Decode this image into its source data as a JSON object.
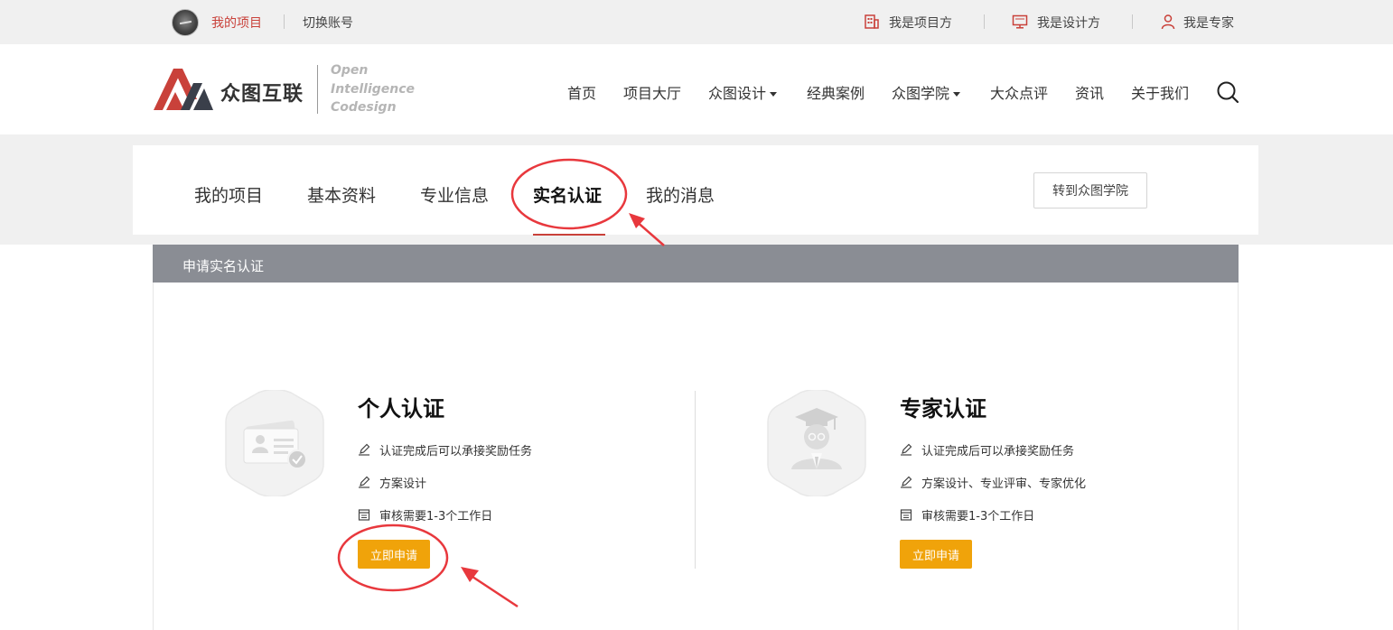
{
  "topbar": {
    "my_projects": "我的项目",
    "switch_account": "切换账号",
    "roles": [
      "我是项目方",
      "我是设计方",
      "我是专家"
    ]
  },
  "header": {
    "logo_cn": "众图互联",
    "logo_en": [
      "Open",
      "Intelligence",
      "Codesign"
    ],
    "nav": [
      {
        "label": "首页",
        "dropdown": false
      },
      {
        "label": "项目大厅",
        "dropdown": false
      },
      {
        "label": "众图设计",
        "dropdown": true
      },
      {
        "label": "经典案例",
        "dropdown": false
      },
      {
        "label": "众图学院",
        "dropdown": true
      },
      {
        "label": "大众点评",
        "dropdown": false
      },
      {
        "label": "资讯",
        "dropdown": false
      },
      {
        "label": "关于我们",
        "dropdown": false
      }
    ]
  },
  "tabs": {
    "items": [
      "我的项目",
      "基本资料",
      "专业信息",
      "实名认证",
      "我的消息"
    ],
    "active": "实名认证",
    "goto_label": "转到众图学院"
  },
  "card": {
    "title": "申请实名认证",
    "personal": {
      "title": "个人认证",
      "features": [
        "认证完成后可以承接奖励任务",
        "方案设计",
        "审核需要1-3个工作日"
      ],
      "button": "立即申请"
    },
    "expert": {
      "title": "专家认证",
      "features": [
        "认证完成后可以承接奖励任务",
        "方案设计、专业评审、专家优化",
        "审核需要1-3个工作日"
      ],
      "button": "立即申请"
    }
  },
  "colors": {
    "brand_red": "#c9413a",
    "button_orange": "#f0a30a",
    "card_header_gray": "#8a8d94",
    "annotation_red": "#e8383d"
  },
  "icons": [
    "avatar",
    "building-icon",
    "monitor-icon",
    "person-icon",
    "logo-mark",
    "search-icon",
    "id-card-icon",
    "expert-avatar-icon",
    "pencil-icon",
    "calendar-icon"
  ]
}
